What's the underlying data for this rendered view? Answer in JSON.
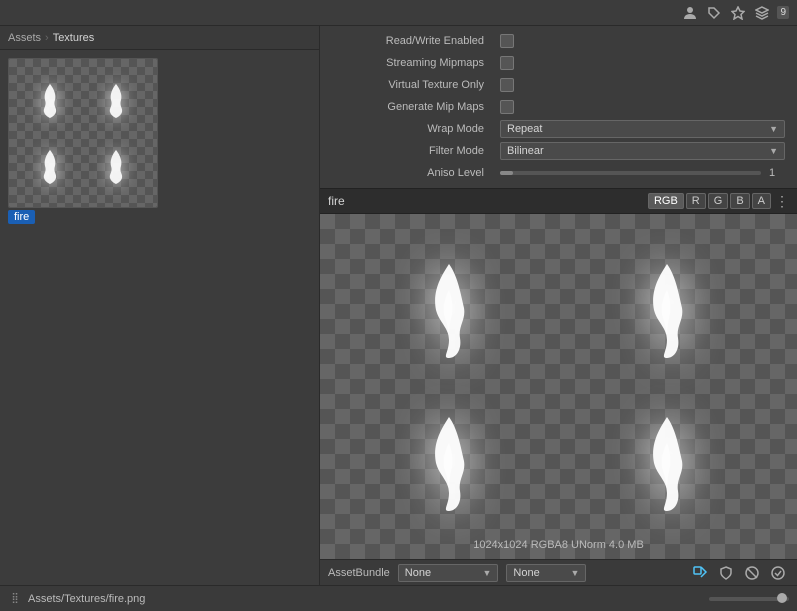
{
  "topbar": {
    "icons": [
      "person-icon",
      "tag-icon",
      "star-icon",
      "layers-icon"
    ],
    "badge": "9"
  },
  "left_panel": {
    "breadcrumb": {
      "parent": "Assets",
      "separator": "›",
      "current": "Textures"
    },
    "asset_name": "fire"
  },
  "inspector": {
    "props": [
      {
        "label": "Read/Write Enabled",
        "type": "checkbox",
        "checked": false
      },
      {
        "label": "Streaming Mipmaps",
        "type": "checkbox",
        "checked": false
      },
      {
        "label": "Virtual Texture Only",
        "type": "checkbox",
        "checked": false
      },
      {
        "label": "Generate Mip Maps",
        "type": "checkbox",
        "checked": false
      }
    ],
    "wrap_mode_label": "Wrap Mode",
    "wrap_mode_value": "Repeat",
    "filter_mode_label": "Filter Mode",
    "filter_mode_value": "Bilinear",
    "aniso_label": "Aniso Level",
    "aniso_value": "1"
  },
  "preview": {
    "name": "fire",
    "channels": [
      "RGB",
      "R",
      "G",
      "B",
      "A"
    ],
    "active_channel": "RGB",
    "texture_info": "1024x1024  RGBA8 UNorm  4.0 MB"
  },
  "bottom": {
    "path": "Assets/Textures/fire.png",
    "asset_bundle_label": "AssetBundle",
    "bundle_value": "None",
    "bundle_variant_value": "None"
  },
  "status_icons": [
    "tag-icon",
    "robot-icon",
    "no-audio-icon",
    "check-icon"
  ]
}
